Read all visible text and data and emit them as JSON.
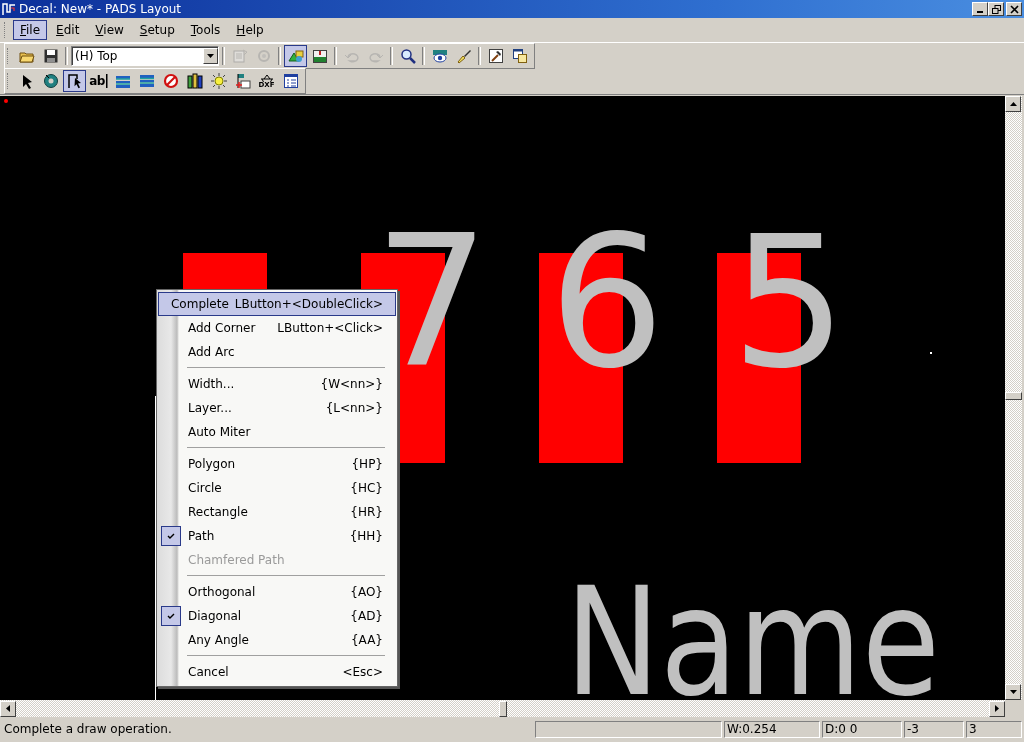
{
  "window": {
    "title": "Decal: New* - PADS Layout"
  },
  "menu_bar": [
    {
      "label": "File",
      "selected": true
    },
    {
      "label": "Edit",
      "selected": false
    },
    {
      "label": "View",
      "selected": false
    },
    {
      "label": "Setup",
      "selected": false
    },
    {
      "label": "Tools",
      "selected": false
    },
    {
      "label": "Help",
      "selected": false
    }
  ],
  "toolbar": {
    "layer_combo": {
      "value": "(H) Top"
    },
    "buttons": [
      {
        "pressed": false,
        "disabled": false
      },
      {
        "pressed": false,
        "disabled": false
      },
      {
        "pressed": false,
        "disabled": true
      },
      {
        "pressed": false,
        "disabled": true
      },
      {
        "pressed": true,
        "disabled": false
      },
      {
        "pressed": false,
        "disabled": false
      },
      {
        "pressed": false,
        "disabled": true
      },
      {
        "pressed": false,
        "disabled": true
      },
      {
        "pressed": false,
        "disabled": false
      },
      {
        "pressed": false,
        "disabled": false
      },
      {
        "pressed": false,
        "disabled": false
      },
      {
        "pressed": false,
        "disabled": false
      },
      {
        "pressed": false,
        "disabled": false
      }
    ]
  },
  "drafting_toolbar": {
    "buttons": [
      {
        "pressed": false
      },
      {
        "pressed": false
      },
      {
        "pressed": true
      },
      {
        "pressed": false,
        "label": "ab"
      },
      {
        "pressed": false
      },
      {
        "pressed": false
      },
      {
        "pressed": false
      },
      {
        "pressed": false
      },
      {
        "pressed": false
      },
      {
        "pressed": false
      },
      {
        "pressed": false,
        "label": "DXF"
      },
      {
        "pressed": false
      }
    ]
  },
  "canvas": {
    "pad_labels": [
      "7",
      "6",
      "5"
    ],
    "name_label": "Name"
  },
  "context_menu": [
    {
      "kind": "item",
      "label": "Complete",
      "shortcut": "LButton+<DoubleClick>",
      "selected": true,
      "checked": false,
      "disabled": false
    },
    {
      "kind": "item",
      "label": "Add Corner",
      "shortcut": "LButton+<Click>",
      "selected": false,
      "checked": false,
      "disabled": false
    },
    {
      "kind": "item",
      "label": "Add Arc",
      "selected": false,
      "checked": false,
      "disabled": false
    },
    {
      "kind": "separator"
    },
    {
      "kind": "item",
      "label": "Width...",
      "shortcut": "{W<nn>}",
      "selected": false,
      "checked": false,
      "disabled": false
    },
    {
      "kind": "item",
      "label": "Layer...",
      "shortcut": "{L<nn>}",
      "selected": false,
      "checked": false,
      "disabled": false
    },
    {
      "kind": "item",
      "label": "Auto Miter",
      "selected": false,
      "checked": false,
      "disabled": false
    },
    {
      "kind": "separator"
    },
    {
      "kind": "item",
      "label": "Polygon",
      "shortcut": "{HP}",
      "selected": false,
      "checked": false,
      "disabled": false
    },
    {
      "kind": "item",
      "label": "Circle",
      "shortcut": "{HC}",
      "selected": false,
      "checked": false,
      "disabled": false
    },
    {
      "kind": "item",
      "label": "Rectangle",
      "shortcut": "{HR}",
      "selected": false,
      "checked": false,
      "disabled": false
    },
    {
      "kind": "item",
      "label": "Path",
      "shortcut": "{HH}",
      "selected": false,
      "checked": true,
      "disabled": false
    },
    {
      "kind": "item",
      "label": "Chamfered Path",
      "selected": false,
      "checked": false,
      "disabled": true
    },
    {
      "kind": "separator"
    },
    {
      "kind": "item",
      "label": "Orthogonal",
      "shortcut": "{AO}",
      "selected": false,
      "checked": false,
      "disabled": false
    },
    {
      "kind": "item",
      "label": "Diagonal",
      "shortcut": "{AD}",
      "selected": false,
      "checked": true,
      "disabled": false
    },
    {
      "kind": "item",
      "label": "Any Angle",
      "shortcut": "{AA}",
      "selected": false,
      "checked": false,
      "disabled": false
    },
    {
      "kind": "separator"
    },
    {
      "kind": "item",
      "label": "Cancel",
      "shortcut": "<Esc>",
      "selected": false,
      "checked": false,
      "disabled": false
    }
  ],
  "status_bar": {
    "message": "Complete a draw operation.",
    "panes": [
      "W:0.254",
      "D:0 0",
      "-3",
      "3"
    ]
  }
}
